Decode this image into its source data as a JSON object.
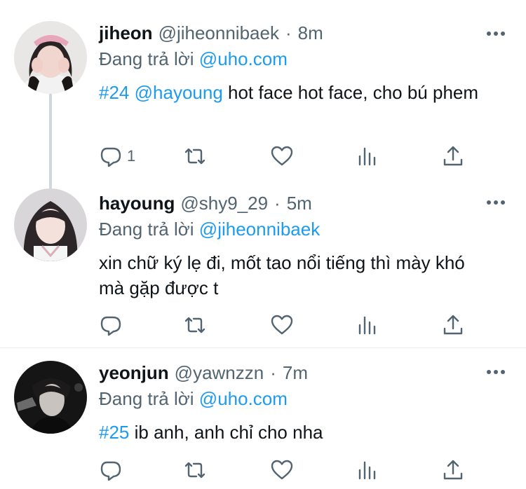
{
  "colors": {
    "link": "#1d9bf0",
    "muted": "#536471",
    "text": "#0f1419",
    "divider": "#e6ecf0"
  },
  "reply_prefix": "Đang trả lời",
  "tweets": [
    {
      "name": "jiheon",
      "handle": "@jiheonnibaek",
      "time": "8m",
      "reply_to": "@uho.com",
      "text_tag": "#24",
      "text_mention": "@hayoung",
      "text_body": "hot face hot face, cho bú phem",
      "reply_count": "1"
    },
    {
      "name": "hayoung",
      "handle": "@shy9_29",
      "time": "5m",
      "reply_to": "@jiheonnibaek",
      "text_body": "xin chữ ký lẹ đi, mốt tao nổi tiếng thì mày khó mà gặp được t"
    },
    {
      "name": "yeonjun",
      "handle": "@yawnzzn",
      "time": "7m",
      "reply_to": "@uho.com",
      "text_tag": "#25",
      "text_body": "ib anh, anh chỉ cho nha"
    }
  ],
  "icons": [
    "reply-icon",
    "retweet-icon",
    "like-icon",
    "views-icon",
    "share-icon",
    "more-icon"
  ]
}
